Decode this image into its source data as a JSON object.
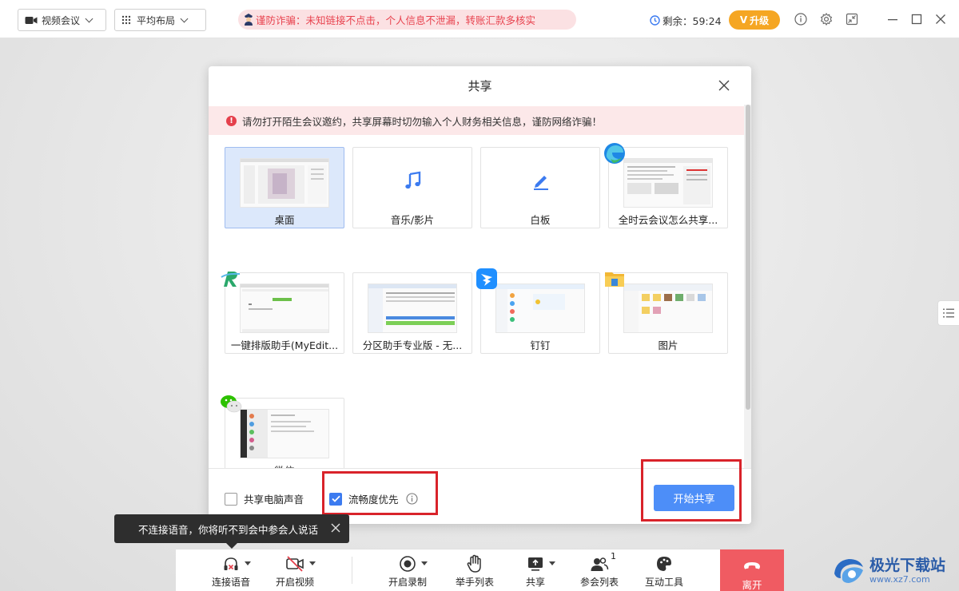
{
  "topbar": {
    "meeting_mode": "视频会议",
    "layout_mode": "平均布局",
    "fraud_warning": "谨防诈骗：未知链接不点击，个人信息不泄漏，转账汇款多核实",
    "timer_label": "剩余：59:24",
    "upgrade_label": "升级",
    "upgrade_prefix": "V"
  },
  "modal": {
    "title": "共享",
    "alert_text": "请勿打开陌生会议邀约，共享屏幕时切勿输入个人财务相关信息，谨防网络诈骗！",
    "alert_icon": "!",
    "tiles": [
      {
        "label": "桌面"
      },
      {
        "label": "音乐/影片"
      },
      {
        "label": "白板"
      },
      {
        "label": "全时云会议怎么共享..."
      },
      {
        "label": "一键排版助手(MyEdit..."
      },
      {
        "label": "分区助手专业版 - 无..."
      },
      {
        "label": "钉钉"
      },
      {
        "label": "图片"
      },
      {
        "label": "微信"
      }
    ],
    "footer": {
      "share_audio_label": "共享电脑声音",
      "share_audio_checked": false,
      "smooth_label": "流畅度优先",
      "smooth_checked": true,
      "start_label": "开始共享"
    }
  },
  "tooltip": {
    "text": "不连接语音，你将听不到会中参会人说话"
  },
  "toolbar": {
    "audio": "连接语音",
    "video": "开启视频",
    "record": "开启录制",
    "raise_hand": "举手列表",
    "share": "共享",
    "participants": "参会列表",
    "participants_count": "1",
    "interact": "互动工具",
    "leave": "离开"
  },
  "watermark": {
    "text": "极光下载站",
    "url": "www.xz7.com"
  },
  "colors": {
    "accent": "#4d8ef8",
    "warning_red": "#e5404c",
    "leave_red": "#f05b62",
    "upgrade_orange": "#f5a623",
    "highlight_box": "#d9232a"
  }
}
